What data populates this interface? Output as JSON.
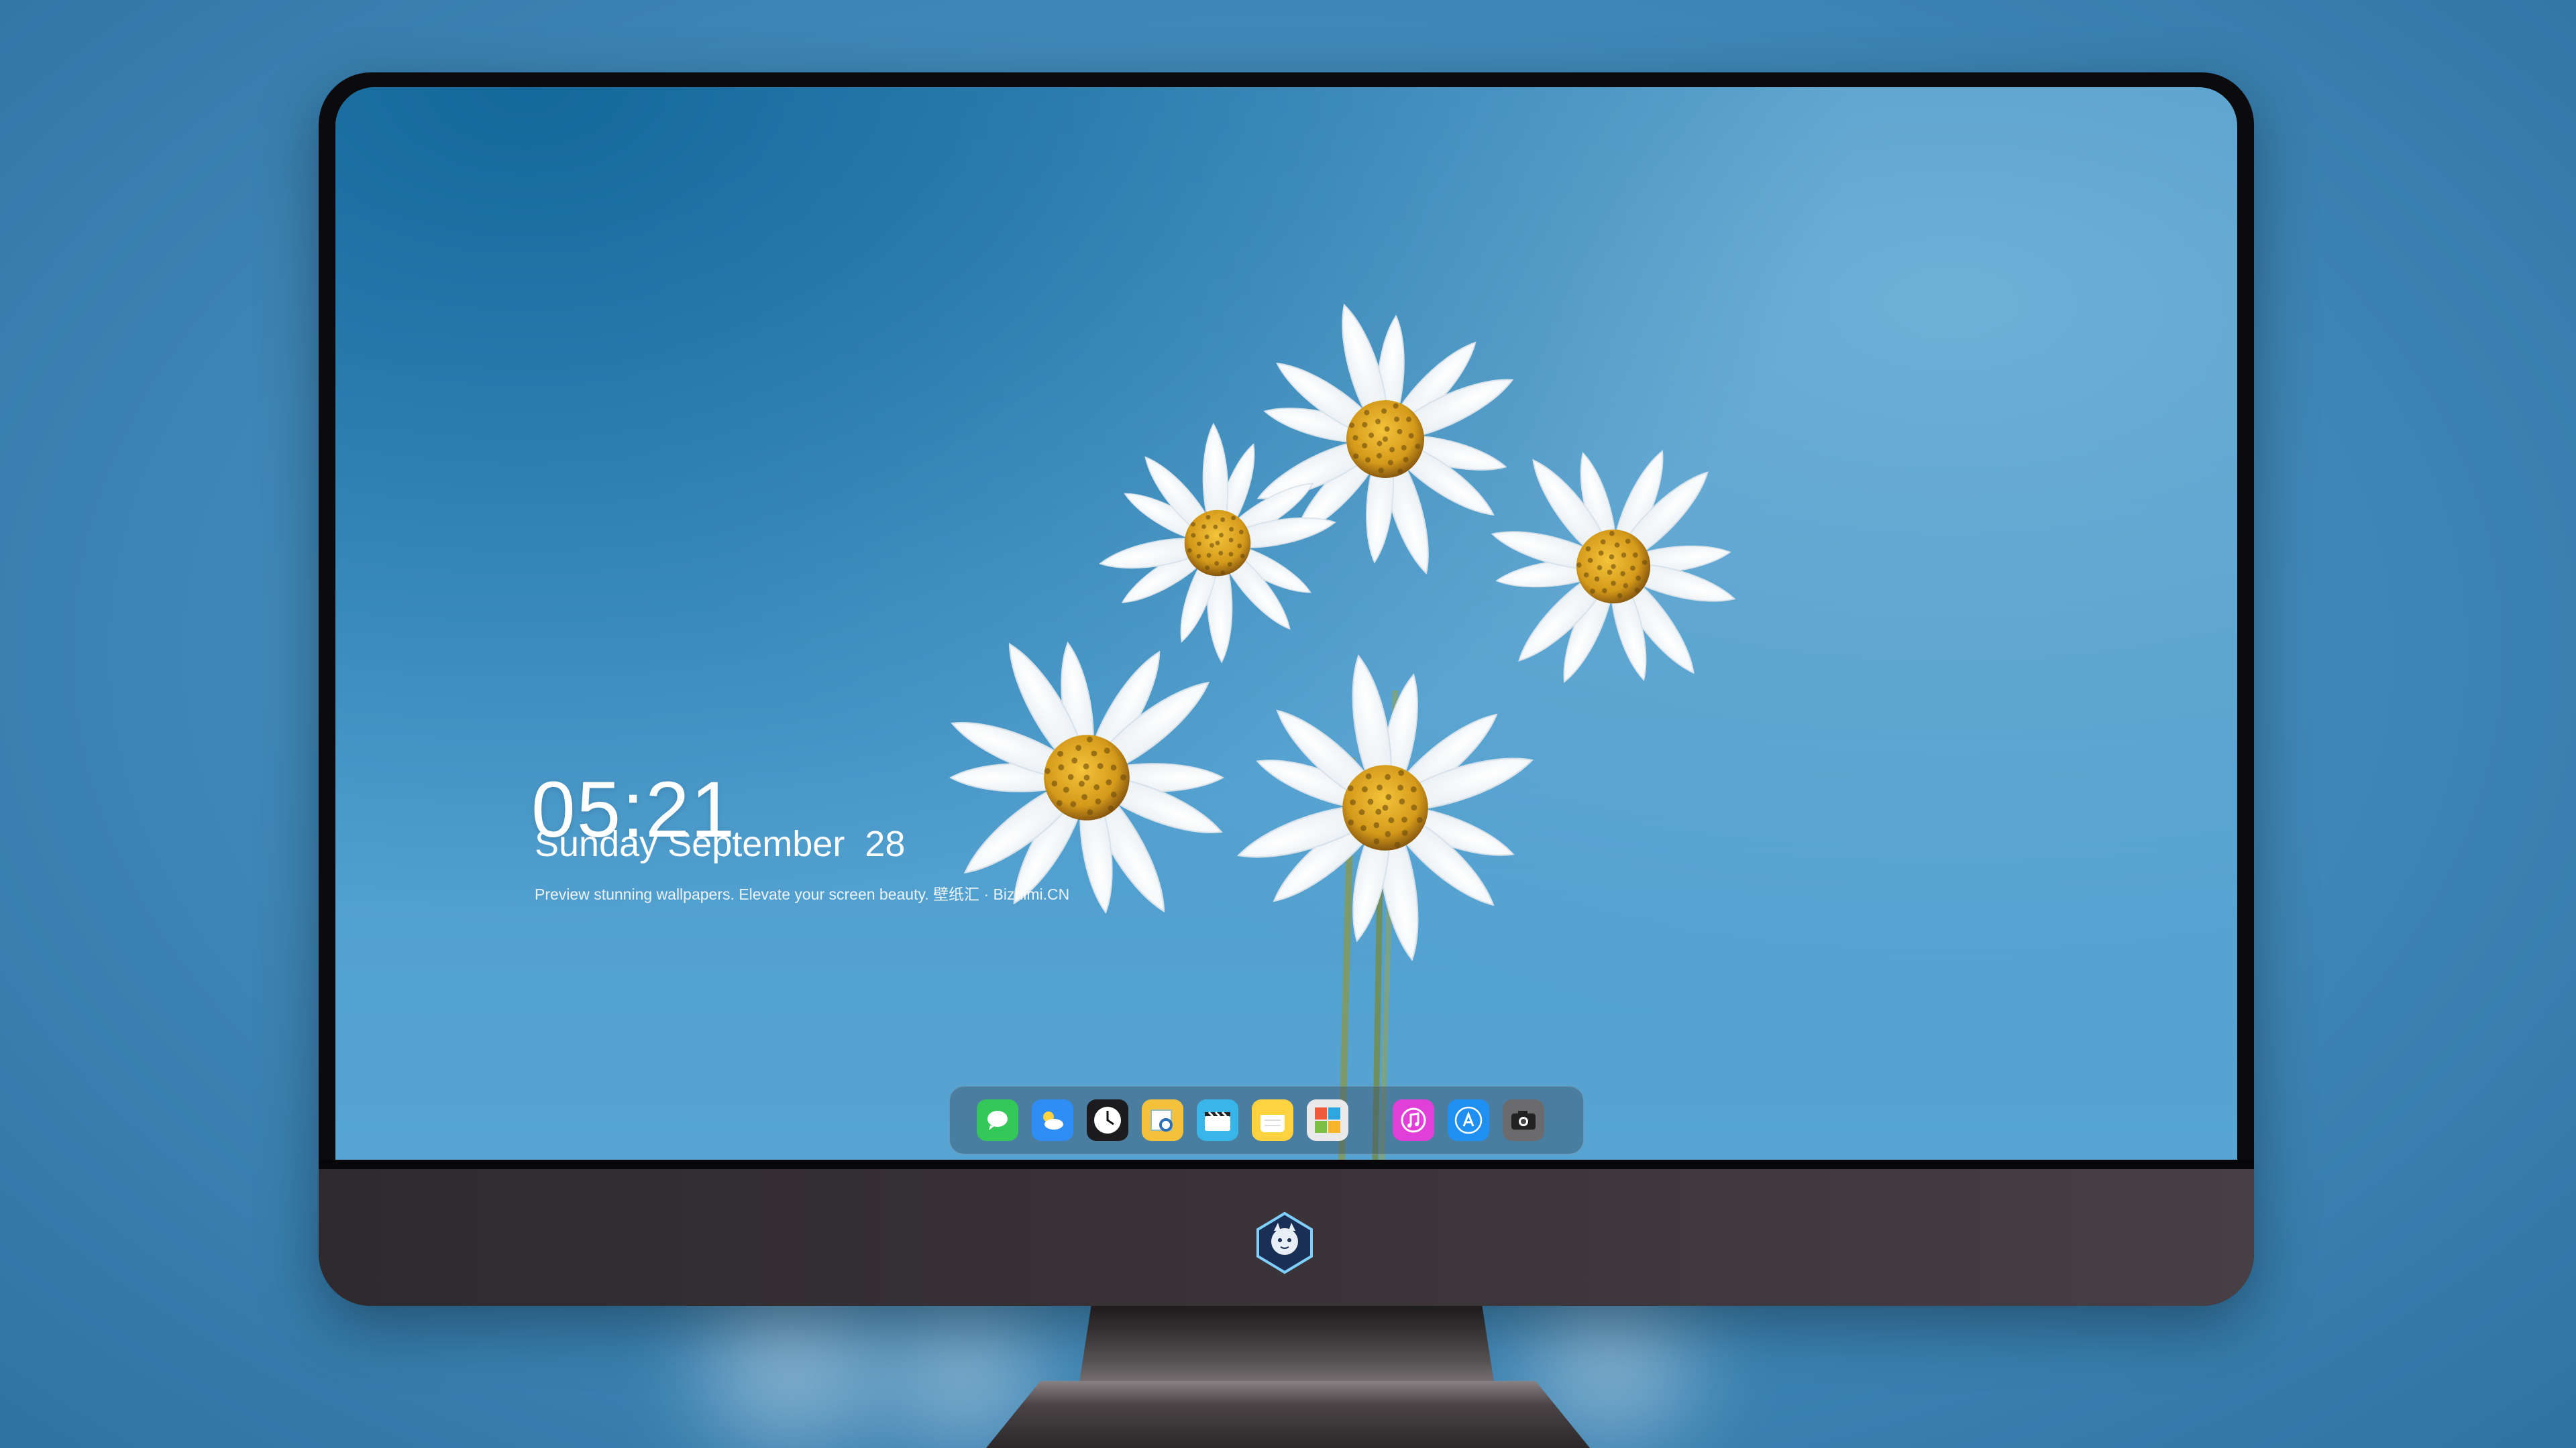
{
  "lock_screen": {
    "time": "05:21",
    "date": "Sunday September  28",
    "tagline": "Preview stunning wallpapers. Elevate your screen beauty. 壁纸汇 · Bizhimi.CN"
  },
  "dock": {
    "apps": [
      {
        "name": "messages-icon",
        "color": "#34c759"
      },
      {
        "name": "weather-icon",
        "color": "#2f8ef5"
      },
      {
        "name": "clock-icon",
        "color": "#1c1c1e"
      },
      {
        "name": "preview-icon",
        "color": "#f3c13a"
      },
      {
        "name": "clips-icon",
        "color": "#39b6e9"
      },
      {
        "name": "notes-icon",
        "color": "#ffd23f"
      },
      {
        "name": "photo-booth-icon",
        "color": "#e9e9e9"
      },
      {
        "name": "music-icon",
        "color": "#e040d8"
      },
      {
        "name": "app-store-icon",
        "color": "#1f8ff2"
      },
      {
        "name": "camera-icon",
        "color": "#6b6b6e"
      }
    ]
  },
  "colors": {
    "accent": "#4d9ccd",
    "bezel": "#0b0b0d",
    "chin": "#3b3438"
  }
}
